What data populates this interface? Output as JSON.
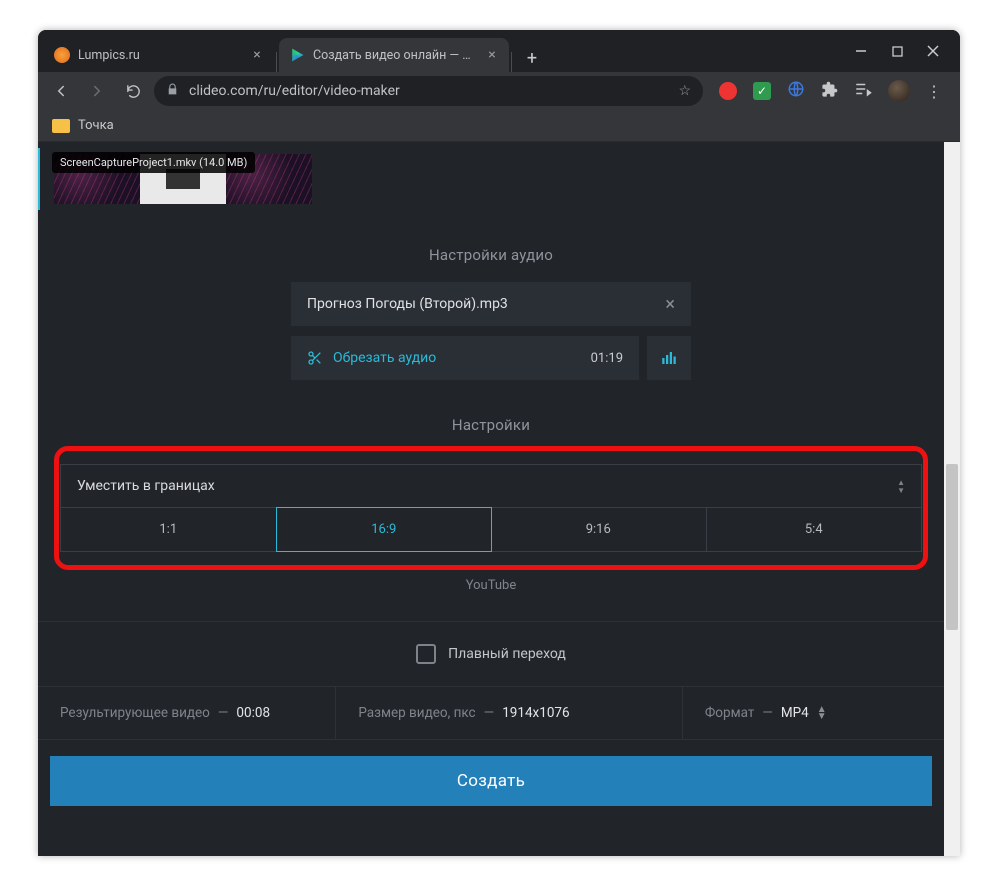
{
  "browser": {
    "tabs": [
      {
        "title": "Lumpics.ru"
      },
      {
        "title": "Создать видео онлайн — Сдел"
      }
    ],
    "url": "clideo.com/ru/editor/video-maker",
    "bookmark": "Точка"
  },
  "clip_tooltip": "ScreenCaptureProject1.mkv (14.0 MB)",
  "audio": {
    "section_title": "Настройки аудио",
    "filename": "Прогноз Погоды (Второй).mp3",
    "trim_label": "Обрезать аудио",
    "duration": "01:19"
  },
  "settings": {
    "section_title": "Настройки",
    "fit_mode": "Уместить в границах",
    "ratios": [
      "1:1",
      "16:9",
      "9:16",
      "5:4"
    ],
    "platform_label": "YouTube"
  },
  "crossfade_label": "Плавный переход",
  "info": {
    "result_label": "Результирующее видео",
    "result_value": "00:08",
    "size_label": "Размер видео, пкс",
    "size_value": "1914x1076",
    "format_label": "Формат",
    "format_value": "MP4"
  },
  "create_button": "Создать"
}
